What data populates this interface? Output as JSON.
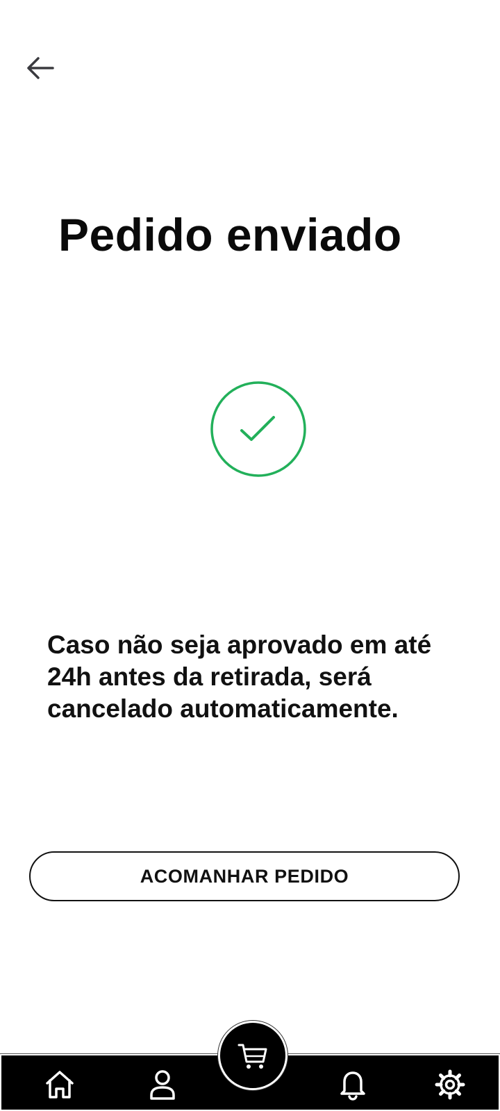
{
  "header": {
    "back_icon": "arrow-left-icon"
  },
  "page": {
    "title": "Pedido enviado",
    "status_icon": "check-circle-icon",
    "message": "Caso não seja aprovado em até 24h antes da retirada, será cancelado automaticamente.",
    "track_button_label": "ACOMANHAR PEDIDO"
  },
  "bottom_nav": {
    "items": [
      {
        "icon": "home-icon"
      },
      {
        "icon": "user-icon"
      },
      {
        "icon": "cart-icon"
      },
      {
        "icon": "bell-icon"
      },
      {
        "icon": "gear-icon"
      }
    ]
  },
  "colors": {
    "success": "#22b05a",
    "nav_background": "#000000",
    "text": "#111111"
  }
}
